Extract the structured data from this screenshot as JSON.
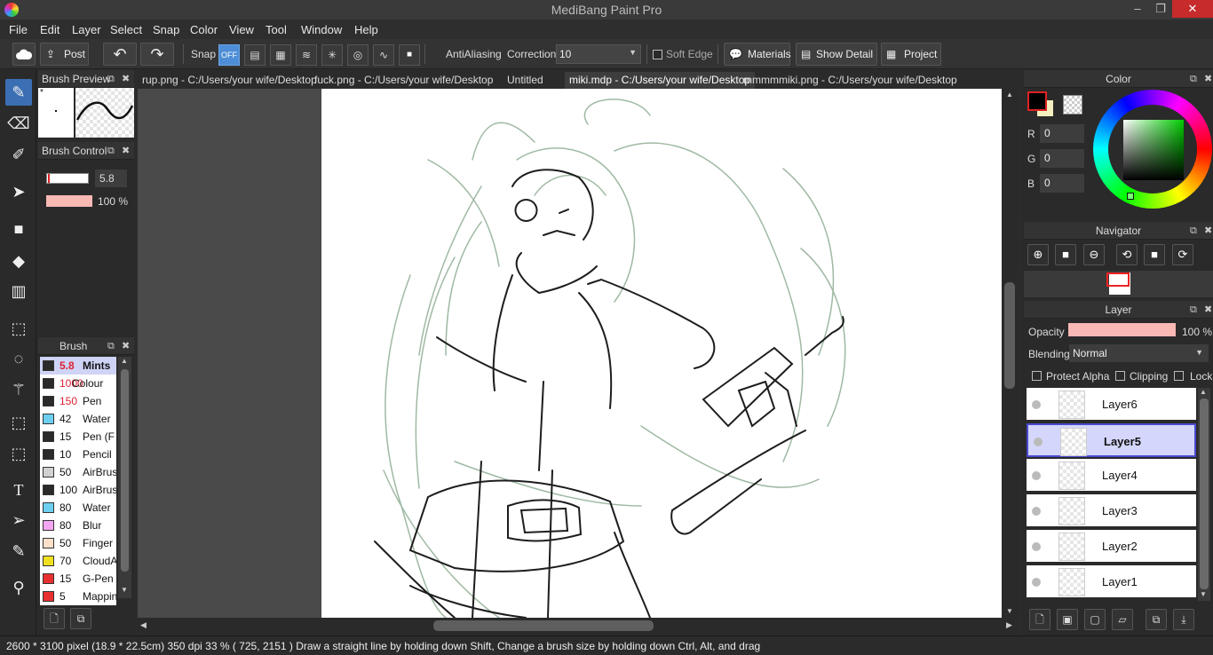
{
  "app": {
    "title": "MediBang Paint Pro"
  },
  "window_controls": {
    "minimize": "–",
    "maximize": "❐",
    "close": "✕"
  },
  "menu": [
    "File",
    "Edit",
    "Layer",
    "Select",
    "Snap",
    "Color",
    "View",
    "Tool",
    "Window",
    "Help"
  ],
  "toolbar": {
    "post": "Post",
    "snap_label": "Snap",
    "snap_off": "OFF",
    "antialiasing_label": "AntiAliasing",
    "correction_label": "Correction",
    "correction_value": "10",
    "soft_edge_label": "Soft Edge",
    "materials": "Materials",
    "show_detail": "Show Detail",
    "project": "Project"
  },
  "tabs": [
    "rup.png - C:/Users/your wife/Desktop",
    "fuck.png - C:/Users/your wife/Desktop",
    "Untitled",
    "miki.mdp - C:/Users/your wife/Desktop",
    "mmmmmiki.png - C:/Users/your wife/Desktop"
  ],
  "brush_preview": {
    "title": "Brush Preview",
    "mark": "*"
  },
  "brush_control": {
    "title": "Brush Control",
    "size": "5.8",
    "opacity": "100 %"
  },
  "brush_panel": {
    "title": "Brush",
    "items": [
      {
        "size": "5.8",
        "name": "Mints",
        "color": "#2a2a2a"
      },
      {
        "size": "1000",
        "name": "Colour",
        "color": "#2a2a2a"
      },
      {
        "size": "150",
        "name": "Pen",
        "color": "#2a2a2a"
      },
      {
        "size": "42",
        "name": "Water",
        "color": "#6ccff0"
      },
      {
        "size": "15",
        "name": "Pen (F",
        "color": "#2a2a2a"
      },
      {
        "size": "10",
        "name": "Pencil",
        "color": "#2a2a2a"
      },
      {
        "size": "50",
        "name": "AirBrus",
        "color": "#d2d2d2"
      },
      {
        "size": "100",
        "name": "AirBrus",
        "color": "#2a2a2a"
      },
      {
        "size": "80",
        "name": "Water",
        "color": "#6ccff0"
      },
      {
        "size": "80",
        "name": "Blur",
        "color": "#f5a6f2"
      },
      {
        "size": "50",
        "name": "Finger",
        "color": "#fde0c9"
      },
      {
        "size": "70",
        "name": "CloudA",
        "color": "#f0e020"
      },
      {
        "size": "15",
        "name": "G-Pen",
        "color": "#e83030"
      },
      {
        "size": "5",
        "name": "Mappin",
        "color": "#e83030"
      }
    ]
  },
  "color_panel": {
    "title": "Color",
    "r_label": "R",
    "r": "0",
    "g_label": "G",
    "g": "0",
    "b_label": "B",
    "b": "0",
    "foreground": "#000000",
    "background": "#f3efbe"
  },
  "navigator": {
    "title": "Navigator"
  },
  "layer_panel": {
    "title": "Layer",
    "opacity_label": "Opacity",
    "opacity_value": "100 %",
    "blending_label": "Blending",
    "blending_value": "Normal",
    "protect_alpha": "Protect Alpha",
    "clipping": "Clipping",
    "lock": "Lock",
    "layers": [
      {
        "name": "Layer6",
        "selected": false
      },
      {
        "name": "Layer5",
        "selected": true
      },
      {
        "name": "Layer4",
        "selected": false
      },
      {
        "name": "Layer3",
        "selected": false
      },
      {
        "name": "Layer2",
        "selected": false
      },
      {
        "name": "Layer1",
        "selected": false
      }
    ]
  },
  "status": {
    "text": "2600 * 3100 pixel   (18.9 * 22.5cm)   350 dpi   33 %   ( 725, 2151 )   Draw a straight line by holding down Shift, Change a brush size by holding down Ctrl, Alt, and drag"
  }
}
